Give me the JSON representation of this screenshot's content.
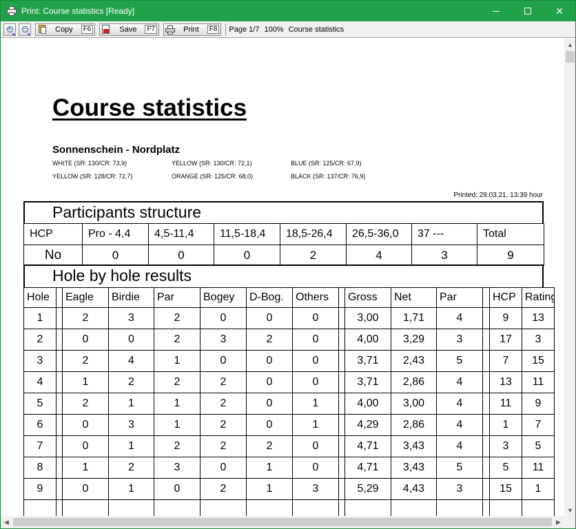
{
  "window": {
    "title": "Print: Course statistics [Ready]",
    "accent_color": "#21a24a"
  },
  "toolbar": {
    "zoom_in_icon": "+",
    "zoom_out_icon": "−",
    "copy_label": "Copy",
    "copy_key": "F6",
    "save_label": "Save",
    "save_key": "F7",
    "print_label": "Print",
    "print_key": "F8",
    "page_info": "Page 1/7",
    "zoom": "100%",
    "doc_name": "Course statistics"
  },
  "document": {
    "title": "Course statistics",
    "course": "Sonnenschein - Nordplatz",
    "tees": [
      "WHITE (SR: 130/CR: 73,9)",
      "YELLOW (SR: 130/CR: 72,1)",
      "BLUE (SR: 125/CR: 67,9)",
      "YELLOW (SR: 128/CR: 72,7)",
      "ORANGE (SR: 125/CR: 68,0)",
      "BLACK (SR: 137/CR: 76,9)"
    ],
    "printed": "Printed: 29.03.21, 13:39 hour",
    "participants": {
      "heading": "Participants structure",
      "hcp_label": "HCP",
      "ranges": [
        "Pro - 4,4",
        "4,5-11,4",
        "11,5-18,4",
        "18,5-26,4",
        "26,5-36,0",
        "37  ---",
        "Total"
      ],
      "no_label": "No",
      "counts": [
        "0",
        "0",
        "0",
        "2",
        "4",
        "3",
        "9"
      ]
    },
    "holes": {
      "heading": "Hole by hole results",
      "columns": [
        "Hole",
        "Eagle",
        "Birdie",
        "Par",
        "Bogey",
        "D-Bog.",
        "Others",
        "Gross",
        "Net",
        "Par",
        "HCP",
        "Rating"
      ],
      "rows": [
        [
          "1",
          "2",
          "3",
          "2",
          "0",
          "0",
          "0",
          "3,00",
          "1,71",
          "4",
          "9",
          "13"
        ],
        [
          "2",
          "0",
          "0",
          "2",
          "3",
          "2",
          "0",
          "4,00",
          "3,29",
          "3",
          "17",
          "3"
        ],
        [
          "3",
          "2",
          "4",
          "1",
          "0",
          "0",
          "0",
          "3,71",
          "2,43",
          "5",
          "7",
          "15"
        ],
        [
          "4",
          "1",
          "2",
          "2",
          "2",
          "0",
          "0",
          "3,71",
          "2,86",
          "4",
          "13",
          "11"
        ],
        [
          "5",
          "2",
          "1",
          "1",
          "2",
          "0",
          "1",
          "4,00",
          "3,00",
          "4",
          "11",
          "9"
        ],
        [
          "6",
          "0",
          "3",
          "1",
          "2",
          "0",
          "1",
          "4,29",
          "2,86",
          "4",
          "1",
          "7"
        ],
        [
          "7",
          "0",
          "1",
          "2",
          "2",
          "2",
          "0",
          "4,71",
          "3,43",
          "4",
          "3",
          "5"
        ],
        [
          "8",
          "1",
          "2",
          "3",
          "0",
          "1",
          "0",
          "4,71",
          "3,43",
          "5",
          "5",
          "11"
        ],
        [
          "9",
          "0",
          "1",
          "0",
          "2",
          "1",
          "3",
          "5,29",
          "4,43",
          "3",
          "15",
          "1"
        ]
      ]
    }
  }
}
